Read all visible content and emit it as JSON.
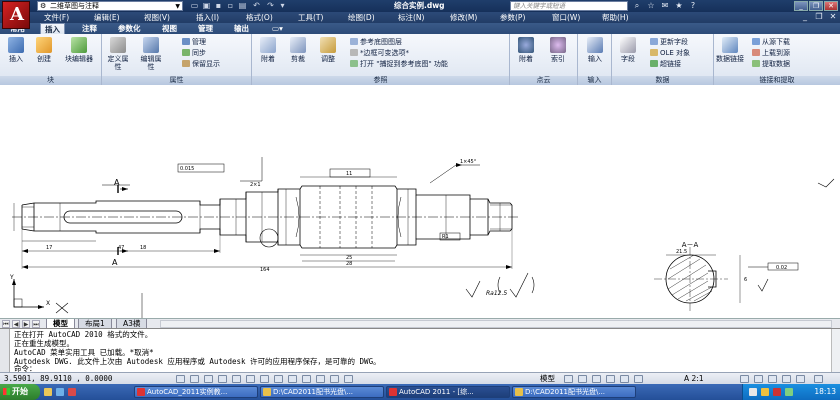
{
  "titlebar": {
    "workspace": "二维草图与注释",
    "doc_title": "综合实例.dwg",
    "search_placeholder": "键入关键字或短语"
  },
  "menubar": {
    "items": [
      "文件(F)",
      "编辑(E)",
      "视图(V)",
      "插入(I)",
      "格式(O)",
      "工具(T)",
      "绘图(D)",
      "标注(N)",
      "修改(M)",
      "参数(P)",
      "窗口(W)",
      "帮助(H)"
    ]
  },
  "ribbon_tabs": [
    "常用",
    "插入",
    "注释",
    "参数化",
    "视图",
    "管理",
    "输出"
  ],
  "active_tab": "插入",
  "ribbon": {
    "block": {
      "title": "块",
      "insert": "插入",
      "create": "创建",
      "block_editor": "块编辑器"
    },
    "attribute": {
      "title": "属性",
      "define": "定义属性",
      "edit": "编辑属性",
      "manage": "管理",
      "sync": "同步",
      "keep_display": "保留显示"
    },
    "reference": {
      "title": "参照",
      "attach": "附着",
      "clip": "剪裁",
      "adjust": "调整",
      "underlay_layers": "参考底图图层",
      "frame_variable": "*边框可变选项*",
      "snap_underlay": "打开 \"捕捉到参考底图\" 功能"
    },
    "point_cloud": {
      "title": "点云",
      "attach": "附着",
      "index": "索引"
    },
    "import": {
      "title": "输入",
      "import": "输入"
    },
    "data": {
      "title": "数据",
      "field": "字段",
      "update_fields": "更新字段",
      "ole_object": "OLE 对象",
      "hyperlink": "超链接"
    },
    "link_extract": {
      "title": "链接和提取",
      "data_link": "数据链接",
      "download_source": "从源下载",
      "upload_source": "上载到源",
      "extract_data": "提取数据"
    }
  },
  "drawing": {
    "section_label": "A－A",
    "section_mark_top": "A",
    "section_mark_bottom": "A",
    "roughness_note": "Ra12.5",
    "dims": {
      "total_length": "164",
      "d_17": "17",
      "d_47": "47",
      "d_18": "18",
      "d_25": "25",
      "d_28": "28",
      "d_11": "11",
      "d_2x1": "2×1",
      "d_1x45": "1×45°",
      "tol_0015": "0.015",
      "tol_002": "0.02",
      "key_depth": "21.5",
      "key_width": "6",
      "radius_mark": "R1"
    },
    "ucs_x": "X",
    "ucs_y": "Y"
  },
  "layout_tabs": [
    "模型",
    "布局1",
    "A3横"
  ],
  "active_layout": "模型",
  "command_history": [
    "正在打开 AutoCAD 2010 格式的文件。",
    "正在重生成模型。",
    "AutoCAD 菜单实用工具 已加载。*取消*",
    "Autodesk DWG.   此文件上次由 Autodesk 应用程序或 Autodesk 许可的应用程序保存，是可靠的 DWG。"
  ],
  "command_prompt": "命令：",
  "statusbar": {
    "coords": "3.5901,  89.9110 , 0.0000",
    "model": "模型",
    "scale": "A 2:1"
  },
  "taskbar": {
    "start": "开始",
    "tasks": [
      "AutoCAD_2011实例教...",
      "D:\\CAD2011配书光盘\\...",
      "AutoCAD 2011 - [综...",
      "D:\\CAD2011配书光盘\\..."
    ],
    "clock": "18:13"
  }
}
